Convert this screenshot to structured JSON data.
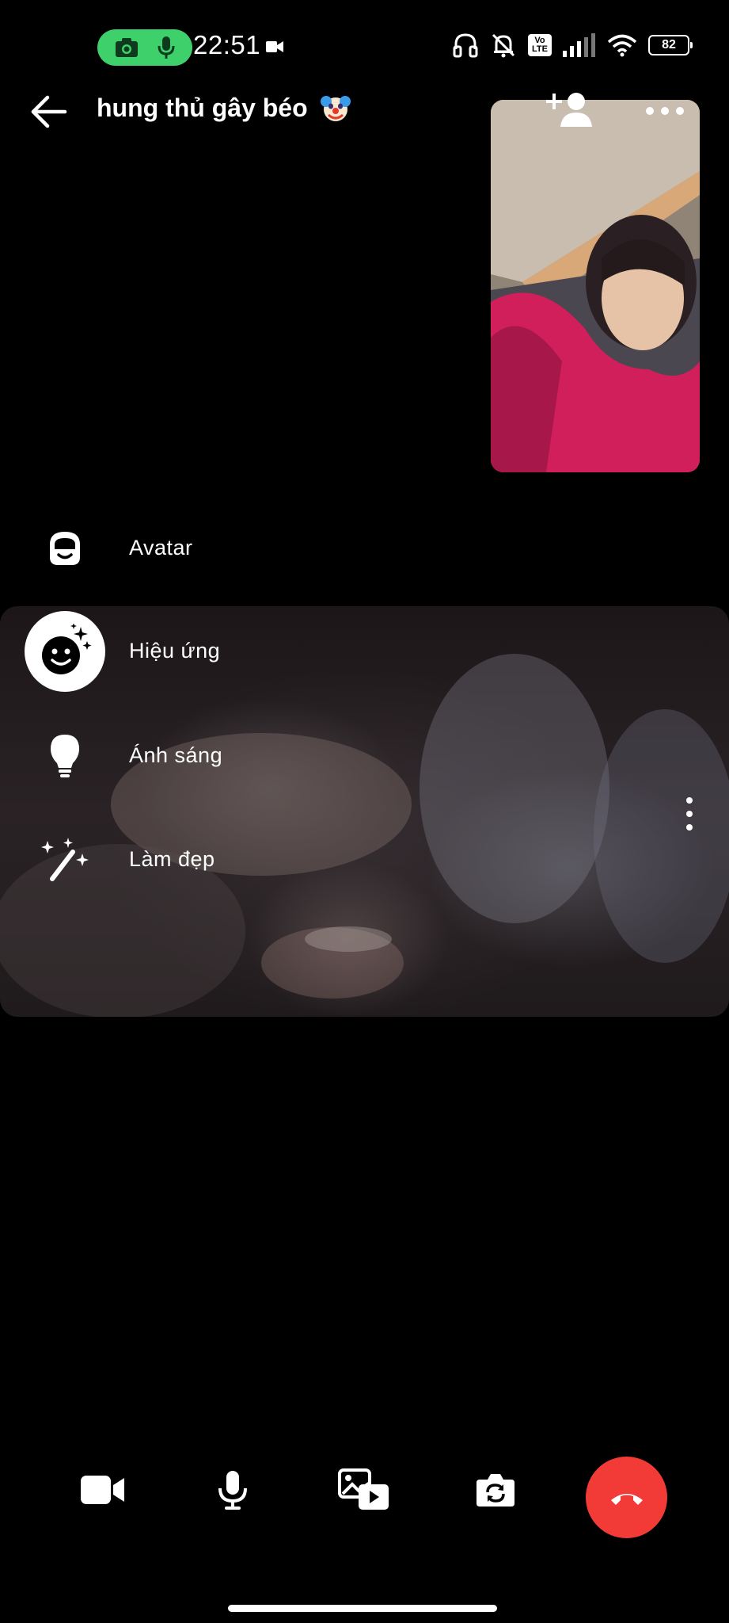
{
  "status_bar": {
    "time": "22:51",
    "battery": "82",
    "volte_label": "Vo\nLTE",
    "icons": [
      "camera-icon",
      "microphone-icon",
      "video-recording-icon",
      "headphones-icon",
      "bell-muted-icon",
      "volte-icon",
      "signal-icon",
      "wifi-icon",
      "battery-icon"
    ]
  },
  "header": {
    "title": "hung thủ gây béo",
    "title_emoji": "clown-face-emoji",
    "back_icon": "arrow-left-icon",
    "add_person_icon": "add-person-icon",
    "more_icon": "more-horizontal-icon"
  },
  "effects_menu": {
    "items": [
      {
        "label": "Avatar",
        "icon": "avatar-icon",
        "selected": false
      },
      {
        "label": "Hiệu ứng",
        "icon": "effects-smiley-icon",
        "selected": true
      },
      {
        "label": "Ánh sáng",
        "icon": "lightbulb-icon",
        "selected": false
      },
      {
        "label": "Làm đẹp",
        "icon": "magic-wand-icon",
        "selected": false
      }
    ]
  },
  "remote_video": {
    "options_icon": "more-vertical-icon"
  },
  "controls": {
    "items": [
      "video-camera-icon",
      "microphone-icon",
      "share-media-icon",
      "flip-camera-icon",
      "end-call-icon"
    ],
    "end_call_color": "#f23a37"
  },
  "colors": {
    "background": "#000000",
    "accent_green": "#3ed06b",
    "end_call": "#f23a37",
    "text": "#ffffff"
  }
}
